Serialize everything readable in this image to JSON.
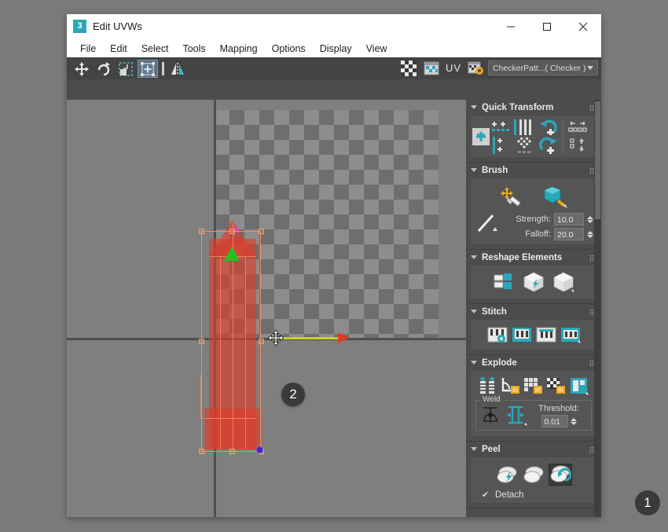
{
  "window": {
    "title": "Edit UVWs",
    "app_icon": "3",
    "controls": {
      "minimize": "minimize-icon",
      "maximize": "maximize-icon",
      "close": "close-icon"
    }
  },
  "menubar": {
    "items": [
      "File",
      "Edit",
      "Select",
      "Tools",
      "Mapping",
      "Options",
      "Display",
      "View"
    ]
  },
  "toolbar": {
    "left_tools": [
      {
        "name": "move-tool",
        "active": false
      },
      {
        "name": "rotate-tool",
        "active": false
      },
      {
        "name": "freeform-mode-tool",
        "active": false
      },
      {
        "name": "scale-tool",
        "active": true
      },
      {
        "name": "mirror-separator",
        "active": false
      },
      {
        "name": "mirror-tool",
        "active": false
      }
    ],
    "right_tools": [
      {
        "name": "show-map-checker-icon"
      },
      {
        "name": "show-map-in-viewport-icon"
      }
    ],
    "uv_label": "UV",
    "map_dropdown": {
      "value": "CheckerPatt...( Checker )",
      "name": "map-selector"
    }
  },
  "viewport": {
    "selection_badge": "2",
    "gizmo": "move-gizmo",
    "axis_label": "X"
  },
  "rollouts": [
    {
      "title": "Quick Transform",
      "name": "quick-transform",
      "expanded": true,
      "tools": [
        "pack-uvs-icon",
        "align-horizontal-icon",
        "align-vertical-icon",
        "straighten-columns-icon",
        "rotate-ccw-90-icon",
        "flip-horizontal-icon",
        "align-to-edge-icon",
        "space-horizontal-icon",
        "relax-icon",
        "space-vertical-icon",
        "rotate-cw-90-icon",
        "flip-vertical-icon"
      ]
    },
    {
      "title": "Brush",
      "name": "brush",
      "expanded": true,
      "tools": [
        "paint-move-brush-icon",
        "paint-relax-brush-icon",
        "brush-falloff-curve-icon"
      ],
      "fields": [
        {
          "label": "Strength:",
          "value": "10.0",
          "name": "brush-strength"
        },
        {
          "label": "Falloff:",
          "value": "20.0",
          "name": "brush-falloff"
        }
      ]
    },
    {
      "title": "Reshape Elements",
      "name": "reshape-elements",
      "expanded": true,
      "tools": [
        "split-uv-icon",
        "quick-peel-icon",
        "peel-mode-icon"
      ]
    },
    {
      "title": "Stitch",
      "name": "stitch",
      "expanded": true,
      "tools": [
        "stitch-settings-icon",
        "stitch-selected-icon",
        "stitch-source-icon",
        "stitch-target-icon"
      ]
    },
    {
      "title": "Explode",
      "name": "explode",
      "expanded": true,
      "tools": [
        "break-icon",
        "explode-by-angle-icon",
        "explode-by-smoothing-icon",
        "explode-by-material-icon",
        "explode-by-polygon-icon"
      ],
      "group": {
        "label": "Weld",
        "name": "weld-group",
        "tools": [
          "target-weld-icon",
          "weld-selected-icon"
        ],
        "field": {
          "label": "Threshold:",
          "value": "0.01",
          "name": "weld-threshold"
        }
      }
    },
    {
      "title": "Peel",
      "name": "peel",
      "expanded": true,
      "tools": [
        "quick-peel-icon",
        "peel-mode-icon",
        "pelt-map-icon"
      ],
      "checkbox": {
        "label": "Detach",
        "checked": true,
        "name": "peel-detach"
      },
      "badge": "1"
    }
  ],
  "colors": {
    "accent_teal": "#2aa7b8",
    "shell_red": "#e13c28",
    "gizmo_yellow": "#cfcf2a",
    "gizmo_red": "#e33a20",
    "panel_bg": "#4c4c4c",
    "viewport_bg": "#7f7f7f"
  }
}
